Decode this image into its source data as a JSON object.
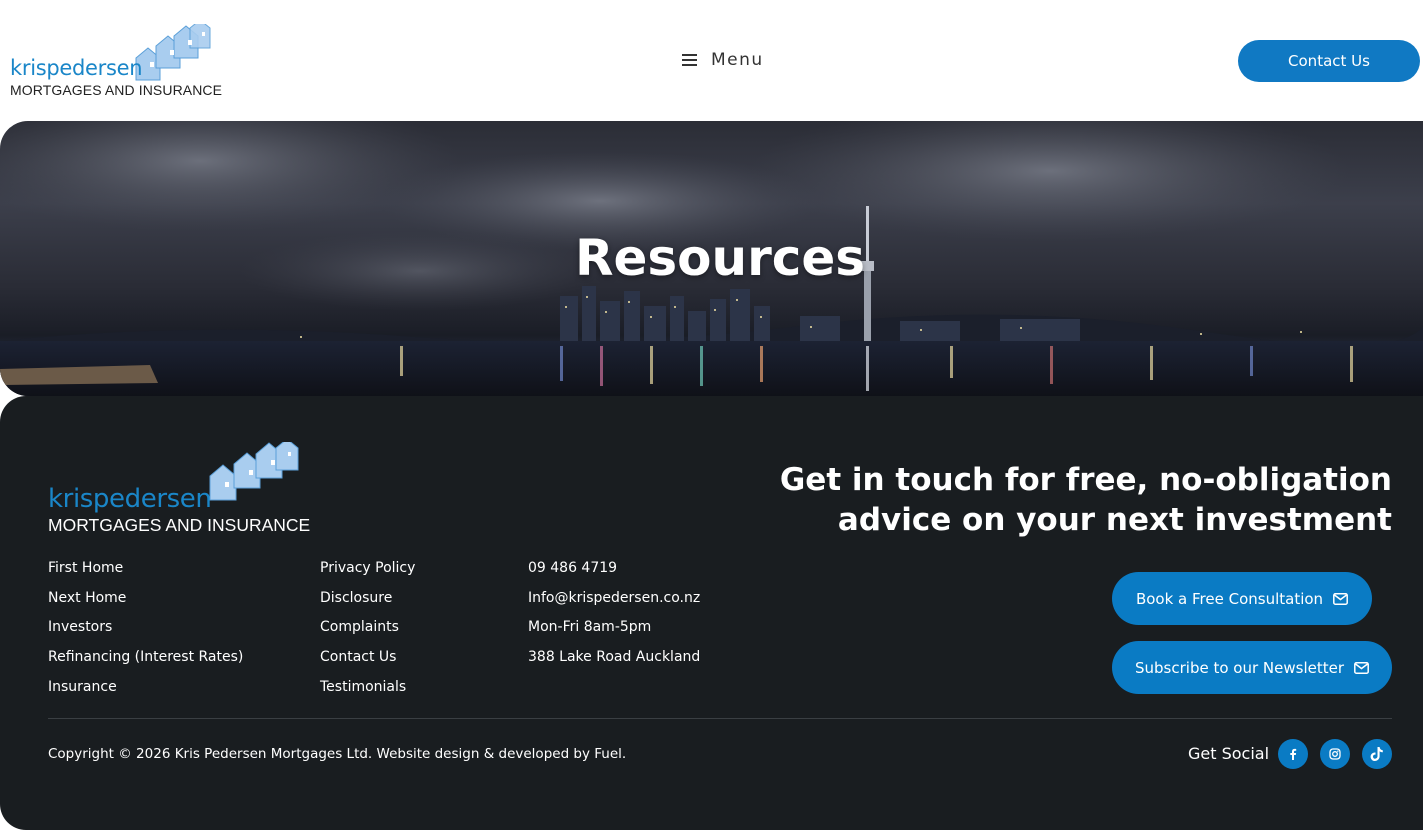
{
  "header": {
    "logo_name": "krispedersen",
    "logo_sub": "MORTGAGES AND INSURANCE",
    "menu_label": "Menu",
    "contact_label": "Contact Us"
  },
  "hero": {
    "title": "Resources"
  },
  "footer": {
    "logo_name": "krispedersen",
    "logo_sub": "MORTGAGES AND INSURANCE",
    "col1": [
      "First Home",
      "Next Home",
      "Investors",
      "Refinancing (Interest Rates)",
      "Insurance"
    ],
    "col2": [
      "Privacy Policy",
      "Disclosure",
      "Complaints",
      "Contact Us",
      "Testimonials"
    ],
    "col3": [
      "09 486 4719",
      "Info@krispedersen.co.nz",
      "Mon-Fri 8am-5pm",
      "388 Lake Road Auckland"
    ],
    "heading": "Get in touch for free, no-obligation advice on your next investment",
    "book_label": "Book a Free Consultation",
    "newsletter_label": "Subscribe to our Newsletter",
    "copyright": "Copyright © 2026 Kris Pedersen Mortgages Ltd. Website design & developed by Fuel.",
    "social_label": "Get Social",
    "social_icons": [
      "facebook-icon",
      "instagram-icon",
      "tiktok-icon"
    ]
  },
  "colors": {
    "brand_blue": "#1079c3",
    "logo_blue": "#1a86c8",
    "footer_bg": "#191d20"
  }
}
